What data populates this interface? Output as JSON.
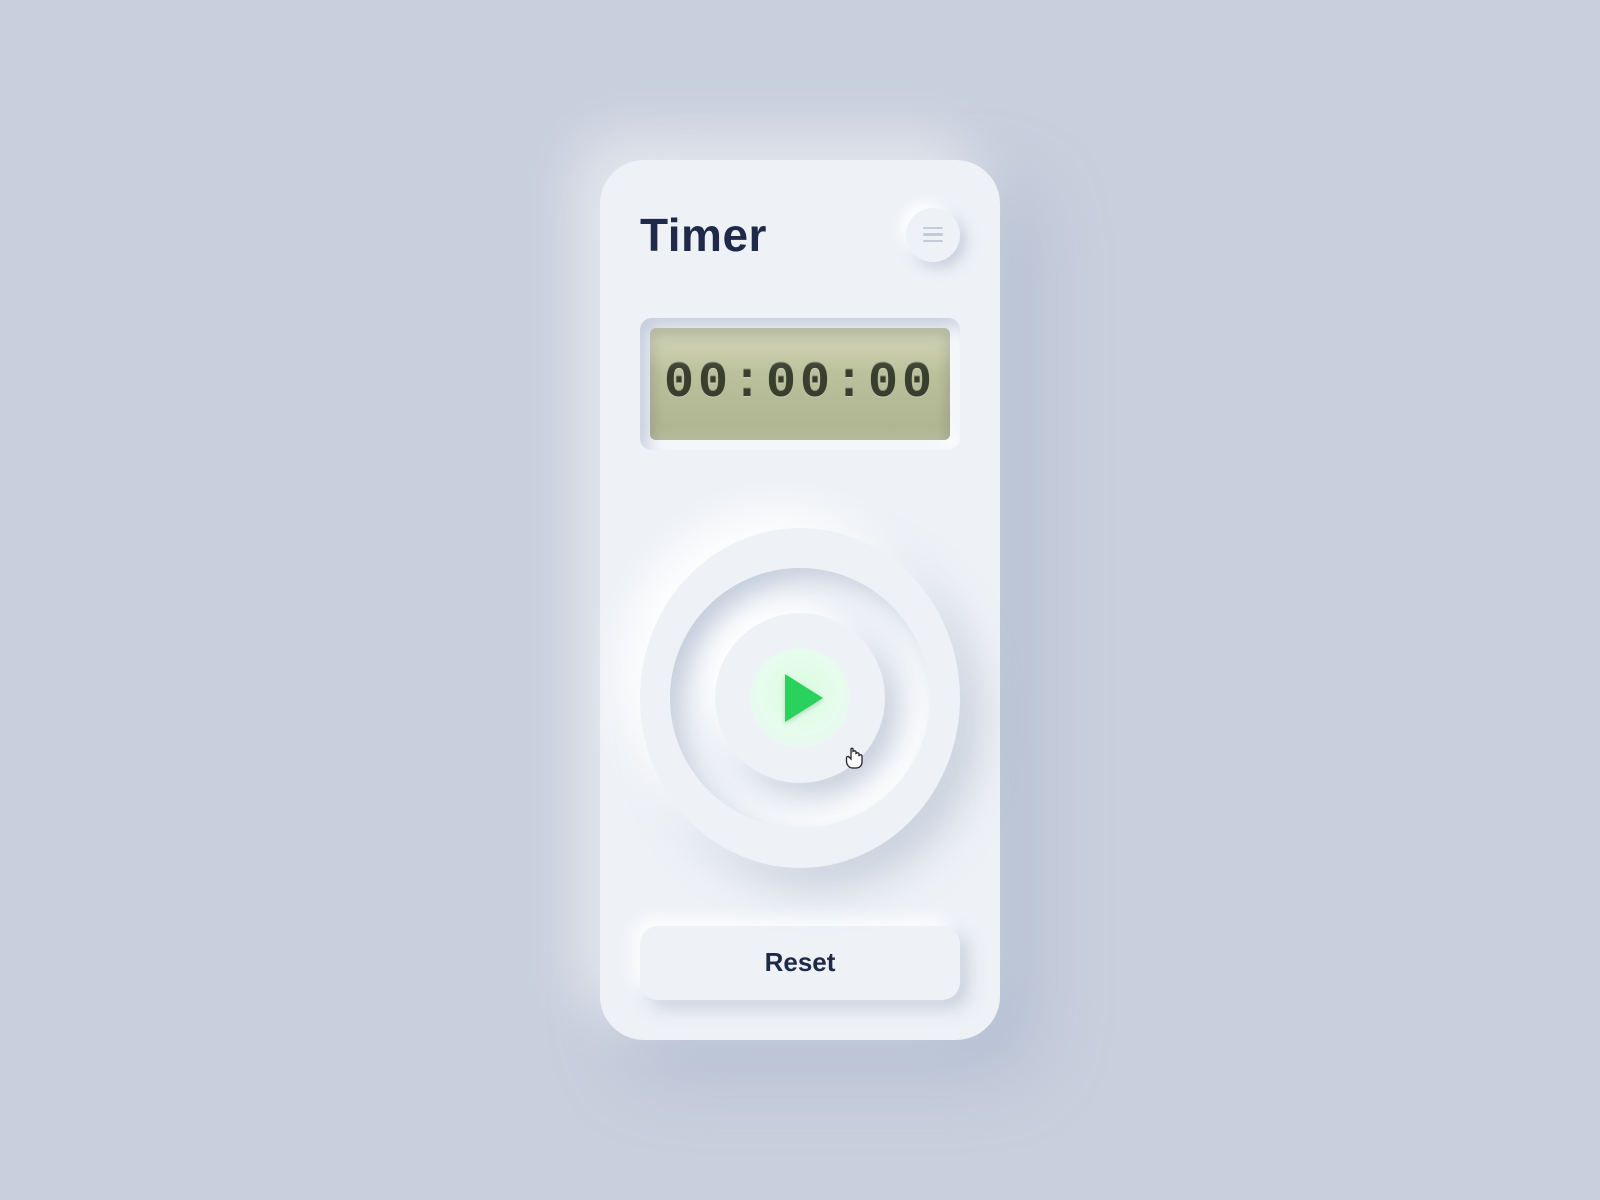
{
  "header": {
    "title": "Timer",
    "menu_icon": "menu-icon"
  },
  "display": {
    "time": "00:00:00"
  },
  "controls": {
    "play_icon": "play-icon",
    "reset_label": "Reset"
  },
  "colors": {
    "background": "#c8cfdd",
    "surface": "#eef1f6",
    "text": "#1f2a49",
    "accent_green": "#29d25d",
    "lcd_bg": "#b8bd99",
    "lcd_text": "#3a3e2e"
  }
}
